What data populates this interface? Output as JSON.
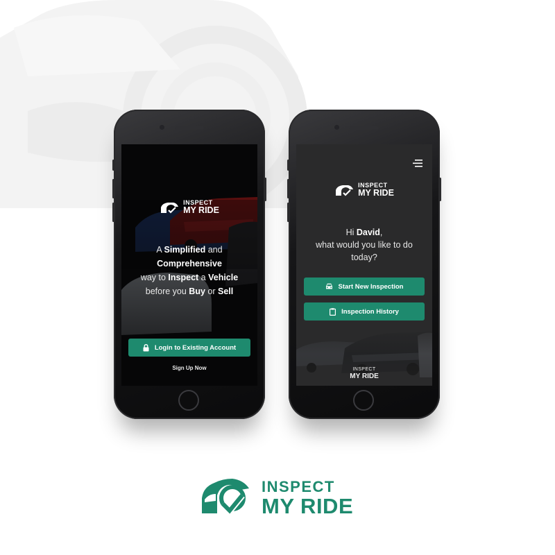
{
  "brand": {
    "line1": "INSPECT",
    "line2": "MY RIDE",
    "color": "#1e8a6e"
  },
  "welcome_screen": {
    "logo": {
      "line1": "INSPECT",
      "line2": "MY RIDE"
    },
    "tagline": {
      "w1": "A ",
      "w2": "Simplified",
      "w3": " and",
      "w4": "Comprehensive",
      "w5": "way to ",
      "w6": "Inspect",
      "w7": " a ",
      "w8": "Vehicle",
      "w9": "before you ",
      "w10": "Buy",
      "w11": " or ",
      "w12": "Sell"
    },
    "login_button": {
      "label": "Login to Existing Account",
      "icon": "lock-icon"
    },
    "signup_link": "Sign Up Now"
  },
  "home_screen": {
    "menu_icon": "hamburger-icon",
    "logo": {
      "line1": "INSPECT",
      "line2": "MY RIDE"
    },
    "greeting": {
      "hi": "Hi ",
      "name": "David",
      "comma": ",",
      "line2": "what would you like to do",
      "line3": "today?"
    },
    "actions": [
      {
        "label": "Start New Inspection",
        "icon": "car-icon"
      },
      {
        "label": "Inspection History",
        "icon": "clipboard-icon"
      }
    ],
    "footer_logo": {
      "line1": "INSPECT",
      "line2": "MY RIDE"
    }
  },
  "colors": {
    "accent": "#1e8a6e",
    "screen_dark": "#060607",
    "screen_gray": "#2a2a2b"
  }
}
